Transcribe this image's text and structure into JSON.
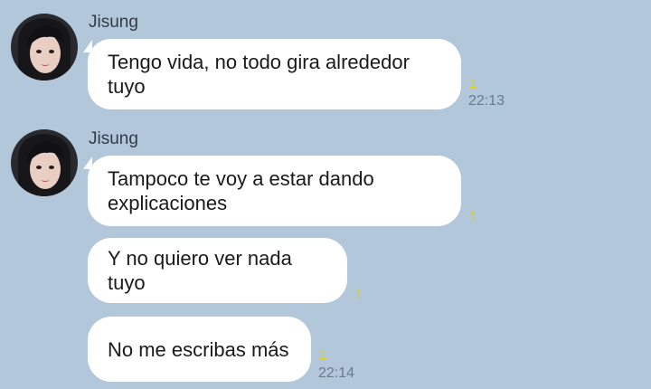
{
  "chat": {
    "groups": [
      {
        "sender": "Jisung",
        "messages": [
          {
            "text": "Tengo vida, no todo gira alrededor tuyo",
            "read_count": "1",
            "time": "22:13"
          }
        ]
      },
      {
        "sender": "Jisung",
        "messages": [
          {
            "text": "Tampoco te voy a estar dando explicaciones",
            "read_count": "1",
            "time": ""
          },
          {
            "text": "Y no quiero ver nada tuyo",
            "read_count": "1",
            "time": ""
          },
          {
            "text": "No me escribas más",
            "read_count": "1",
            "time": "22:14"
          }
        ]
      }
    ]
  },
  "colors": {
    "background": "#b3c7db",
    "bubble": "#ffffff",
    "read_indicator": "#e6d000",
    "time": "#6b7a88"
  },
  "icons": {
    "avatar": "profile-avatar"
  }
}
